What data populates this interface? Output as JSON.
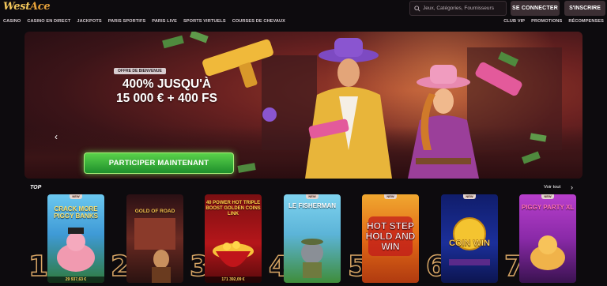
{
  "header": {
    "logo": {
      "part1": "West",
      "part2": "Ace"
    },
    "search_placeholder": "Jeux, Catégories, Fournisseurs",
    "login_label": "SE CONNECTER",
    "signup_label": "S'INSCRIRE"
  },
  "nav": {
    "left": [
      "CASINO",
      "CASINO EN DIRECT",
      "JACKPOTS",
      "PARIS SPORTIFS",
      "PARIS LIVE",
      "SPORTS VIRTUELS",
      "COURSES DE CHEVAUX"
    ],
    "right": [
      "CLUB VIP",
      "PROMOTIONS",
      "RÉCOMPENSES"
    ]
  },
  "banner": {
    "badge": "OFFRE DE BIENVENUE",
    "line1": "400% JUSQU'À",
    "line2": "15 000 € + 400 FS",
    "cta": "PARTICIPER MAINTENANT",
    "prev_icon": "chevron-left-icon",
    "next_icon": "chevron-right-icon",
    "slides": 4,
    "active_slide": 1
  },
  "top": {
    "title": "TOP",
    "see_all": "Voir tout",
    "games": [
      {
        "rank": "1",
        "title": "CRACK MORE PIGGY BANKS",
        "badge": "NEW",
        "jackpot": "29 937,63 €"
      },
      {
        "rank": "2",
        "title": "GOLD OF ROAD",
        "badge": "",
        "jackpot": ""
      },
      {
        "rank": "3",
        "title": "40 POWER HOT TRIPLE BOOST GOLDEN COINS LINK",
        "badge": "",
        "jackpot": "171 392,09 €"
      },
      {
        "rank": "4",
        "title": "LE FISHERMAN",
        "badge": "NEW",
        "jackpot": ""
      },
      {
        "rank": "5",
        "title": "HOT STEP HOLD AND WIN",
        "badge": "NEW",
        "jackpot": ""
      },
      {
        "rank": "6",
        "title": "COIN WIN",
        "badge": "NEW",
        "jackpot": ""
      },
      {
        "rank": "7",
        "title": "PIGGY PARTY XL",
        "badge": "NEW",
        "jackpot": ""
      }
    ]
  },
  "colors": {
    "accent_gold": "#f3c75c",
    "cta_green": "#2fae3a",
    "button_bg": "#3b2e33",
    "page_bg": "#0d0b0e"
  }
}
